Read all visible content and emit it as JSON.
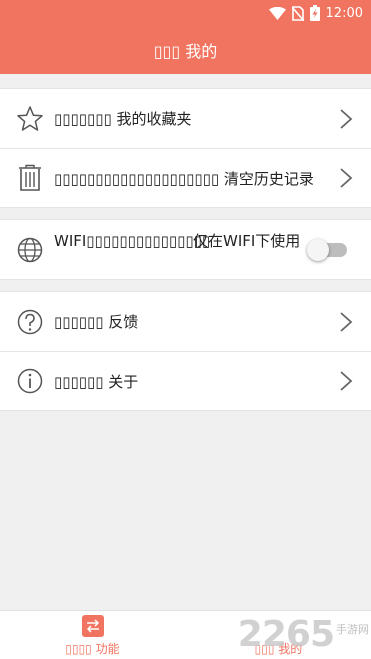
{
  "status_bar": {
    "time": "12:00"
  },
  "app_bar": {
    "title": "▯▯▯ 我的"
  },
  "menu": {
    "favorites_label": "▯▯▯▯▯▯▯ 我的收藏夹",
    "clear_history_label": "▯▯▯▯▯▯▯▯▯▯▯▯▯▯▯▯▯▯▯▯ 清空历史记录",
    "wifi_label_prefix": "WIFI▯▯▯▯▯▯▯▯▯▯▯▯▯▯▯",
    "wifi_label": "仅在WIFI下使用",
    "wifi_enabled": false,
    "feedback_label": "▯▯▯▯▯▯ 反馈",
    "about_label": "▯▯▯▯▯▯ 关于"
  },
  "bottom_nav": {
    "functions_label": "▯▯▯▯ 功能",
    "mine_label": "▯▯▯ 我的"
  },
  "watermark": {
    "number": "2265",
    "text": "手游网"
  },
  "colors": {
    "accent": "#f0745f",
    "background": "#f0f0f0"
  }
}
